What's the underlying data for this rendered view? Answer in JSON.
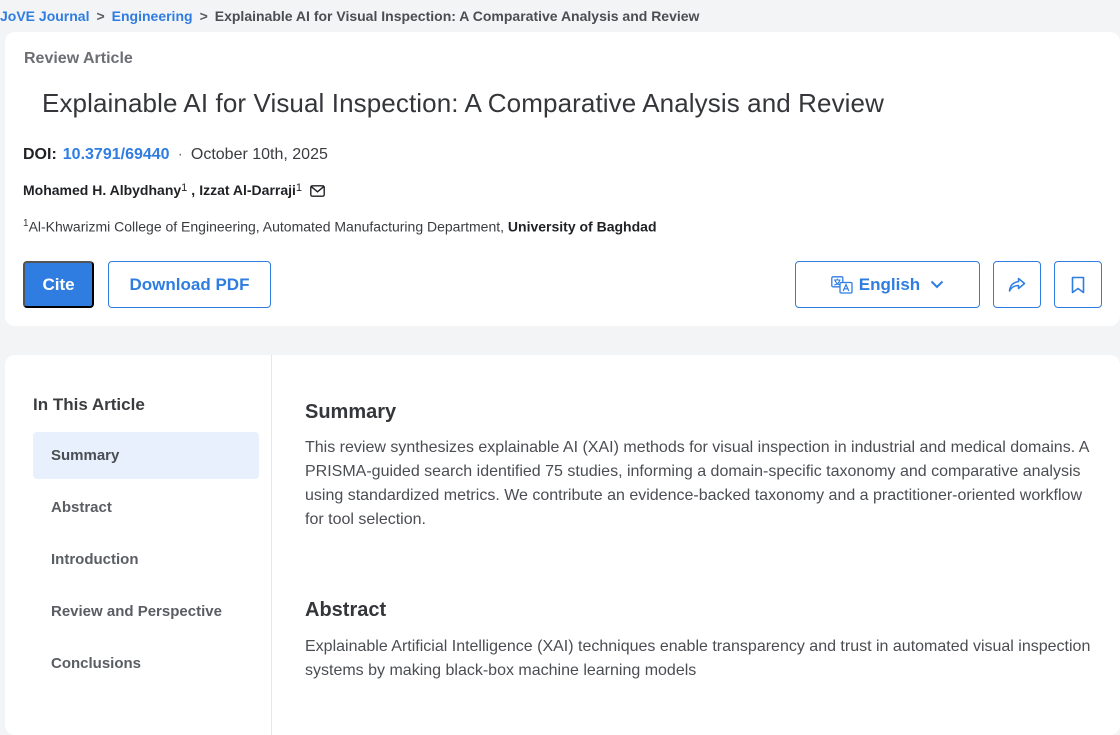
{
  "breadcrumb": {
    "home": "JoVE Journal",
    "separator": ">",
    "section": "Engineering",
    "current": "Explainable AI for Visual Inspection: A Comparative Analysis and Review"
  },
  "article": {
    "type": "Review Article",
    "title": "Explainable AI for Visual Inspection: A Comparative Analysis and Review",
    "doi_label": "DOI:",
    "doi": "10.3791/69440",
    "date_separator": "·",
    "date": "October 10th, 2025",
    "authors": [
      {
        "name": "Mohamed H. Albydhany",
        "affiliation_ref": "1"
      },
      {
        "name": "Izzat Al-Darraji",
        "affiliation_ref": "1"
      }
    ],
    "author_separator": ",",
    "affiliation": {
      "ref": "1",
      "text": "Al-Khwarizmi College of Engineering, Automated Manufacturing Department,",
      "university": "University of Baghdad"
    }
  },
  "actions": {
    "cite_label": "Cite",
    "download_pdf_label": "Download PDF",
    "language_label": "English"
  },
  "colors": {
    "accent": "#2f7de1",
    "toc_active_bg": "#e7f0fc",
    "page_bg": "#f3f4f6"
  },
  "icons": {
    "author_contact": "mail-icon",
    "language": "translate-icon",
    "language_dropdown": "chevron-down-icon",
    "share": "share-icon",
    "bookmark": "bookmark-icon"
  },
  "toc": {
    "title": "In This Article",
    "items": [
      {
        "label": "Summary",
        "active": true
      },
      {
        "label": "Abstract",
        "active": false
      },
      {
        "label": "Introduction",
        "active": false
      },
      {
        "label": "Review and Perspective",
        "active": false
      },
      {
        "label": "Conclusions",
        "active": false
      }
    ]
  },
  "sections": {
    "summary": {
      "heading": "Summary",
      "text": "This review synthesizes explainable AI (XAI) methods for visual inspection in industrial and medical domains. A PRISMA-guided search identified 75 studies, informing a domain-specific taxonomy and comparative analysis using standardized metrics. We contribute an evidence-backed taxonomy and a practitioner-oriented workflow for tool selection."
    },
    "abstract": {
      "heading": "Abstract",
      "text": "Explainable Artificial Intelligence (XAI) techniques enable transparency and trust in automated visual inspection systems by making black-box machine learning models"
    }
  }
}
